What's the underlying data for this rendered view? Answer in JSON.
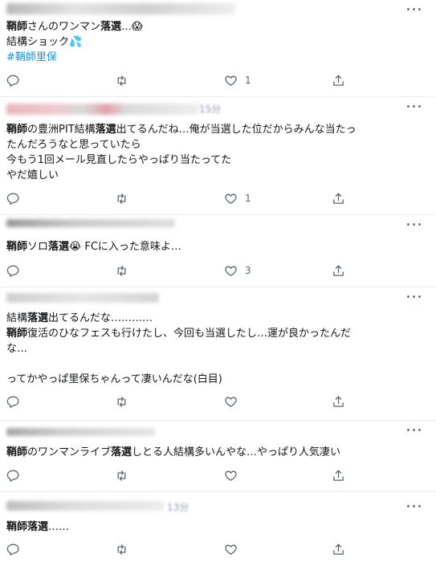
{
  "tweets": [
    {
      "time_text": "",
      "lines": [
        [
          {
            "t": "鞘師",
            "b": true
          },
          {
            "t": "さんのワンマン"
          },
          {
            "t": "落選",
            "b": true
          },
          {
            "t": "…😱"
          }
        ],
        [
          {
            "t": "結構ショック💦"
          }
        ],
        [
          {
            "t": "#鞘師里保",
            "tag": true
          }
        ]
      ],
      "like_count": "1"
    },
    {
      "time_text": "15分",
      "lines": [
        [
          {
            "t": "鞘師",
            "b": true
          },
          {
            "t": "の豊洲PIT結構"
          },
          {
            "t": "落選",
            "b": true
          },
          {
            "t": "出てるんだね…俺が当選した位だからみんな当たっ"
          }
        ],
        [
          {
            "t": "たんだろうなと思っていたら"
          }
        ],
        [
          {
            "t": "今もう1回メール見直したらやっぱり当たってた"
          }
        ],
        [
          {
            "t": "やだ嬉しい"
          }
        ]
      ],
      "like_count": "1"
    },
    {
      "time_text": "",
      "lines": [
        [
          {
            "t": "鞘師",
            "b": true
          },
          {
            "t": "ソロ"
          },
          {
            "t": "落選",
            "b": true
          },
          {
            "t": "😭 FCに入った意味よ…"
          }
        ]
      ],
      "like_count": "3"
    },
    {
      "time_text": "",
      "lines": [
        [
          {
            "t": "結構"
          },
          {
            "t": "落選",
            "b": true
          },
          {
            "t": "出てるんだな…………"
          }
        ],
        [
          {
            "t": "鞘師",
            "b": true
          },
          {
            "t": "復活のひなフェスも行けたし、今回も当選したし…運が良かったんだ"
          }
        ],
        [
          {
            "t": "な…"
          }
        ],
        [
          {
            "t": ""
          }
        ],
        [
          {
            "t": "ってかやっぱ里保ちゃんって凄いんだな(白目)"
          }
        ]
      ],
      "like_count": ""
    },
    {
      "time_text": "",
      "lines": [
        [
          {
            "t": "鞘師",
            "b": true
          },
          {
            "t": "のワンマンライブ"
          },
          {
            "t": "落選",
            "b": true
          },
          {
            "t": "しとる人結構多いんやな…やっぱり人気凄い"
          }
        ]
      ],
      "like_count": ""
    },
    {
      "time_text": "13分",
      "lines": [
        [
          {
            "t": "鞘師",
            "b": true
          },
          {
            "t": "落選",
            "b": true
          },
          {
            "t": "……"
          }
        ]
      ],
      "like_count": ""
    }
  ]
}
